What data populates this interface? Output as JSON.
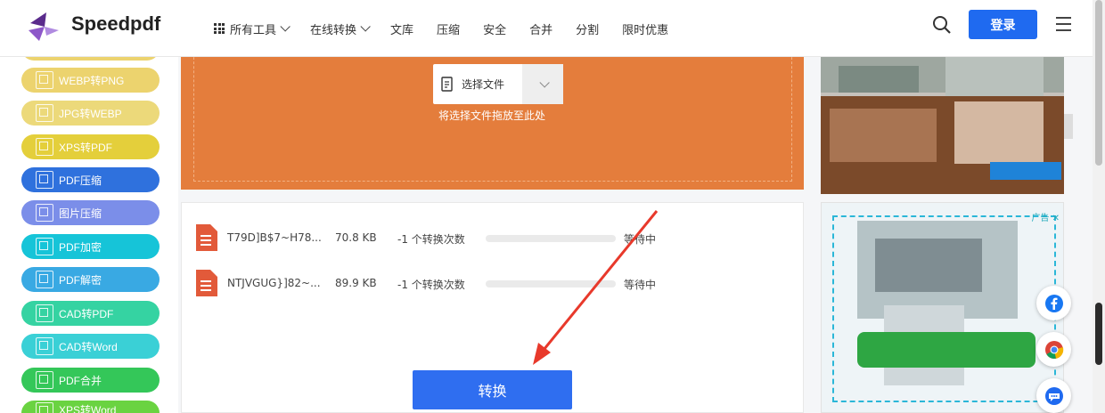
{
  "header": {
    "logo_text": "Speedpdf",
    "nav": [
      {
        "label": "所有工具",
        "dropdown": true,
        "grid": true
      },
      {
        "label": "在线转换",
        "dropdown": true
      },
      {
        "label": "文库"
      },
      {
        "label": "压缩"
      },
      {
        "label": "安全"
      },
      {
        "label": "合并"
      },
      {
        "label": "分割"
      },
      {
        "label": "限时优惠"
      }
    ],
    "login_label": "登录"
  },
  "sidebar": {
    "items": [
      {
        "label": "WEBP转PNG",
        "color": "#ecd36e"
      },
      {
        "label": "JPG转WEBP",
        "color": "#ecd97a"
      },
      {
        "label": "XPS转PDF",
        "color": "#e4cf3b"
      },
      {
        "label": "PDF压缩",
        "color": "#2f71dd"
      },
      {
        "label": "图片压缩",
        "color": "#7b8ee9"
      },
      {
        "label": "PDF加密",
        "color": "#16c4d8"
      },
      {
        "label": "PDF解密",
        "color": "#39a9e3"
      },
      {
        "label": "CAD转PDF",
        "color": "#35d3a2"
      },
      {
        "label": "CAD转Word",
        "color": "#3ad0d6"
      },
      {
        "label": "PDF合并",
        "color": "#34c759"
      },
      {
        "label": "XPS转Word",
        "color": "#6ad341"
      }
    ]
  },
  "upload": {
    "choose_label": "选择文件",
    "drop_hint": "将选择文件拖放至此处",
    "bg_color": "#e47d3c"
  },
  "files": [
    {
      "name": "T79D]B$7~H78...",
      "size": "70.8 KB",
      "count": "-1 个转换次数",
      "status": "等待中",
      "progress": 0
    },
    {
      "name": "NTJVGUG}]82~...",
      "size": "89.9 KB",
      "count": "-1 个转换次数",
      "status": "等待中",
      "progress": 0
    }
  ],
  "convert_label": "转换",
  "ad": {
    "label": "广告"
  },
  "social": [
    "facebook-icon",
    "chrome-icon",
    "chat-icon"
  ],
  "colors": {
    "primary": "#1f6af0",
    "convert": "#2f6ef0",
    "file_icon": "#e25a3a"
  }
}
